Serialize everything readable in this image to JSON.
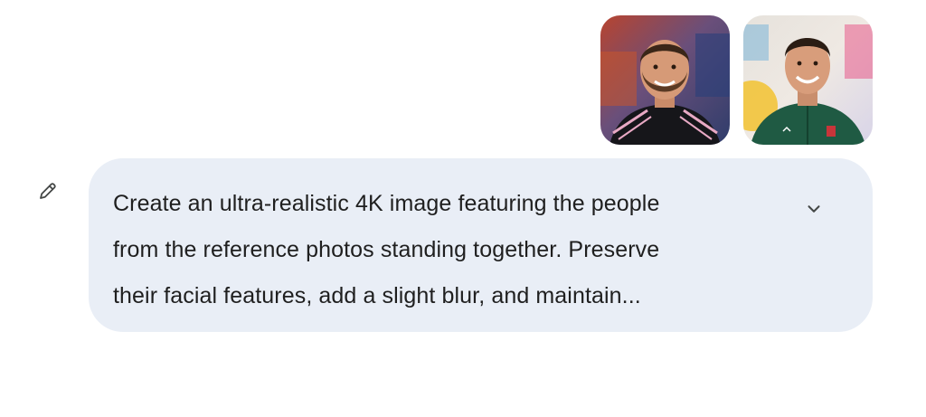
{
  "attachments": [
    {
      "icon": "photo-thumbnail-icon"
    },
    {
      "icon": "photo-thumbnail-icon"
    }
  ],
  "edit_button": {
    "icon": "pencil-icon"
  },
  "message": {
    "lines": [
      "Create an ultra-realistic 4K image featuring the people",
      "from the reference photos standing together. Preserve",
      "their facial features, add a slight blur, and maintain..."
    ],
    "expand_icon": "chevron-down-icon"
  },
  "colors": {
    "bubble_background": "#e9eef6",
    "text": "#1f1f1f",
    "icon": "#444746"
  }
}
